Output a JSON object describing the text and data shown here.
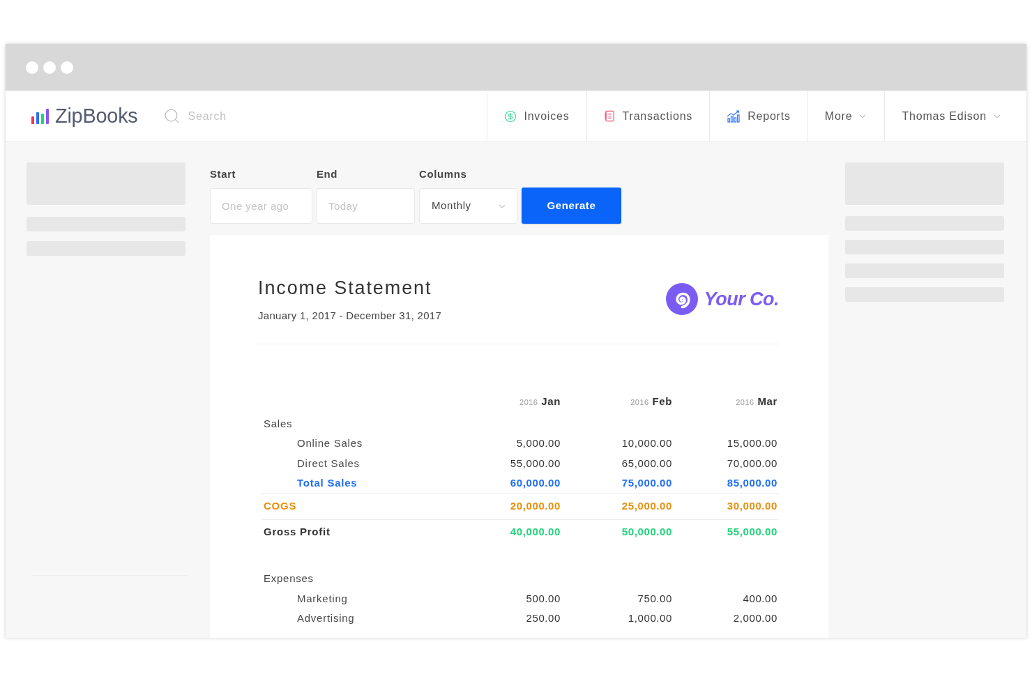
{
  "header": {
    "logo": "ZipBooks",
    "search": {
      "placeholder": "Search"
    },
    "nav": [
      {
        "label": "Invoices",
        "kind": "link"
      },
      {
        "label": "Transactions",
        "kind": "link"
      },
      {
        "label": "Reports",
        "kind": "link"
      },
      {
        "label": "More",
        "kind": "dropdown"
      },
      {
        "label": "Thomas Edison",
        "kind": "dropdown"
      }
    ]
  },
  "report_form": {
    "fields": [
      {
        "label": "Start",
        "placeholder": "One year ago"
      },
      {
        "label": "End",
        "placeholder": "Today"
      }
    ],
    "columns_select": {
      "label": "Columns",
      "value": "Monthly"
    },
    "generate_button": "Generate"
  },
  "report": {
    "title": "Income Statement",
    "date_range": "January 1, 2017 - December 31, 2017",
    "company_logo": "Your Co.",
    "columns": [
      {
        "year": "2016",
        "month": "Jan"
      },
      {
        "year": "2016",
        "month": "Feb"
      },
      {
        "year": "2016",
        "month": "Mar"
      }
    ],
    "rows": [
      {
        "kind": "heading",
        "label": "Sales"
      },
      {
        "kind": "line",
        "label": "Online Sales",
        "values": [
          "5,000.00",
          "10,000.00",
          "15,000.00"
        ]
      },
      {
        "kind": "line",
        "label": "Direct Sales",
        "values": [
          "55,000.00",
          "65,000.00",
          "70,000.00"
        ]
      },
      {
        "kind": "subtotal",
        "label": "Total Sales",
        "values": [
          "60,000.00",
          "75,000.00",
          "85,000.00"
        ]
      },
      {
        "kind": "cost",
        "label": "COGS",
        "values": [
          "20,000.00",
          "25,000.00",
          "30,000.00"
        ]
      },
      {
        "kind": "profit",
        "label": "Gross Profit",
        "values": [
          "40,000.00",
          "50,000.00",
          "55,000.00"
        ]
      },
      {
        "kind": "heading",
        "label": "Expenses"
      },
      {
        "kind": "line",
        "label": "Marketing",
        "values": [
          "500.00",
          "750.00",
          "400.00"
        ]
      },
      {
        "kind": "line",
        "label": "Advertising",
        "values": [
          "250.00",
          "1,000.00",
          "2,000.00"
        ]
      }
    ]
  }
}
